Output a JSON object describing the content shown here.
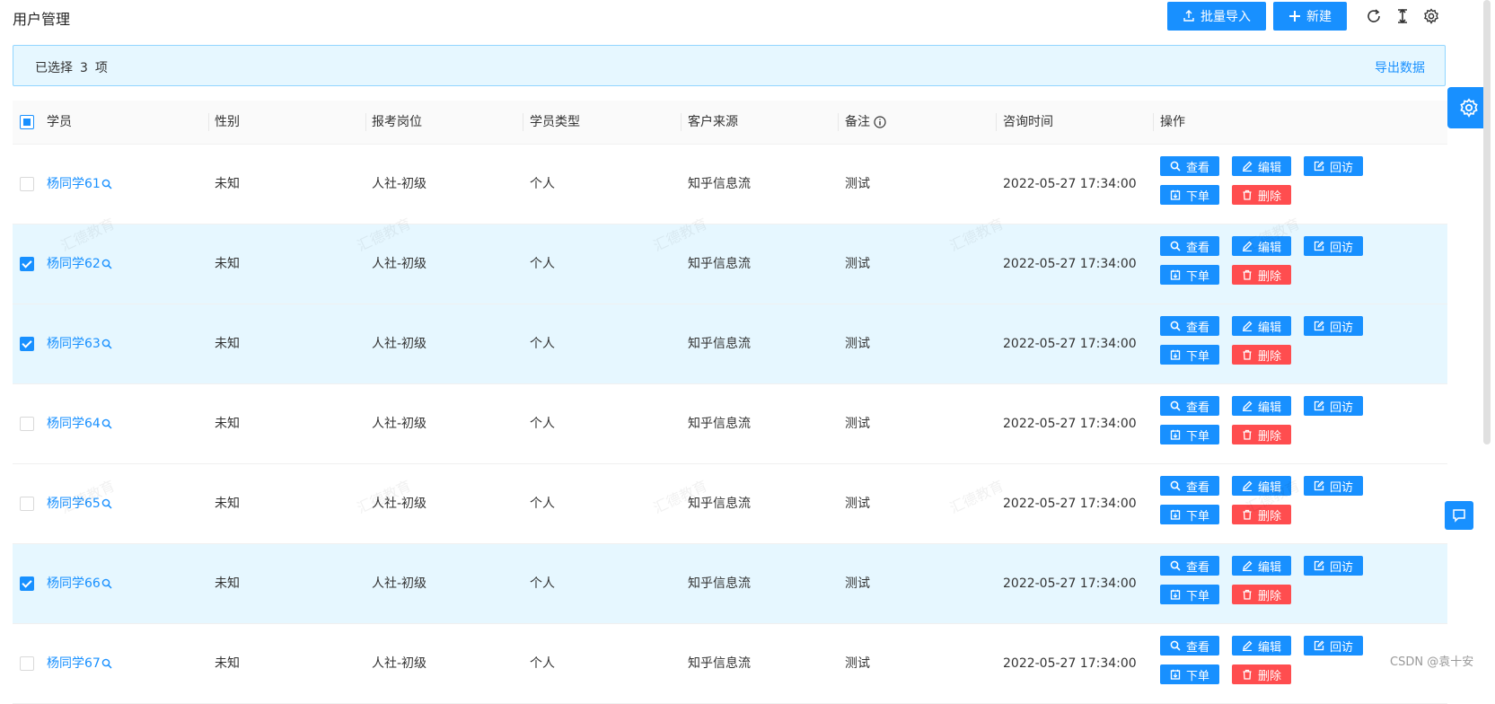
{
  "header": {
    "title": "用户管理",
    "import_label": "批量导入",
    "new_label": "新建"
  },
  "selection": {
    "prefix": "已选择",
    "count": "3",
    "suffix": "项",
    "export_label": "导出数据"
  },
  "table": {
    "columns": [
      "学员",
      "性别",
      "报考岗位",
      "学员类型",
      "客户来源",
      "备注",
      "咨询时间",
      "操作"
    ],
    "actions": {
      "view": "查看",
      "edit": "编辑",
      "revisit": "回访",
      "order": "下单",
      "delete": "删除"
    },
    "rows": [
      {
        "name": "杨同学61",
        "gender": "未知",
        "position": "人社-初级",
        "type": "个人",
        "source": "知乎信息流",
        "note": "测试",
        "time": "2022-05-27 17:34:00",
        "selected": false
      },
      {
        "name": "杨同学62",
        "gender": "未知",
        "position": "人社-初级",
        "type": "个人",
        "source": "知乎信息流",
        "note": "测试",
        "time": "2022-05-27 17:34:00",
        "selected": true
      },
      {
        "name": "杨同学63",
        "gender": "未知",
        "position": "人社-初级",
        "type": "个人",
        "source": "知乎信息流",
        "note": "测试",
        "time": "2022-05-27 17:34:00",
        "selected": true
      },
      {
        "name": "杨同学64",
        "gender": "未知",
        "position": "人社-初级",
        "type": "个人",
        "source": "知乎信息流",
        "note": "测试",
        "time": "2022-05-27 17:34:00",
        "selected": false
      },
      {
        "name": "杨同学65",
        "gender": "未知",
        "position": "人社-初级",
        "type": "个人",
        "source": "知乎信息流",
        "note": "测试",
        "time": "2022-05-27 17:34:00",
        "selected": false
      },
      {
        "name": "杨同学66",
        "gender": "未知",
        "position": "人社-初级",
        "type": "个人",
        "source": "知乎信息流",
        "note": "测试",
        "time": "2022-05-27 17:34:00",
        "selected": true
      },
      {
        "name": "杨同学67",
        "gender": "未知",
        "position": "人社-初级",
        "type": "个人",
        "source": "知乎信息流",
        "note": "测试",
        "time": "2022-05-27 17:34:00",
        "selected": false
      }
    ]
  },
  "watermark": "汇德教育",
  "footer": {
    "credit": "CSDN @袁十安"
  },
  "colors": {
    "primary": "#1890ff",
    "danger": "#ff4d4f",
    "selected_row": "#e6f7ff"
  },
  "icons": [
    "upload-icon",
    "plus-icon",
    "reload-icon",
    "column-height-icon",
    "setting-icon",
    "info-icon",
    "search-icon",
    "edit-icon",
    "form-icon",
    "order-icon",
    "delete-icon",
    "chat-icon"
  ]
}
